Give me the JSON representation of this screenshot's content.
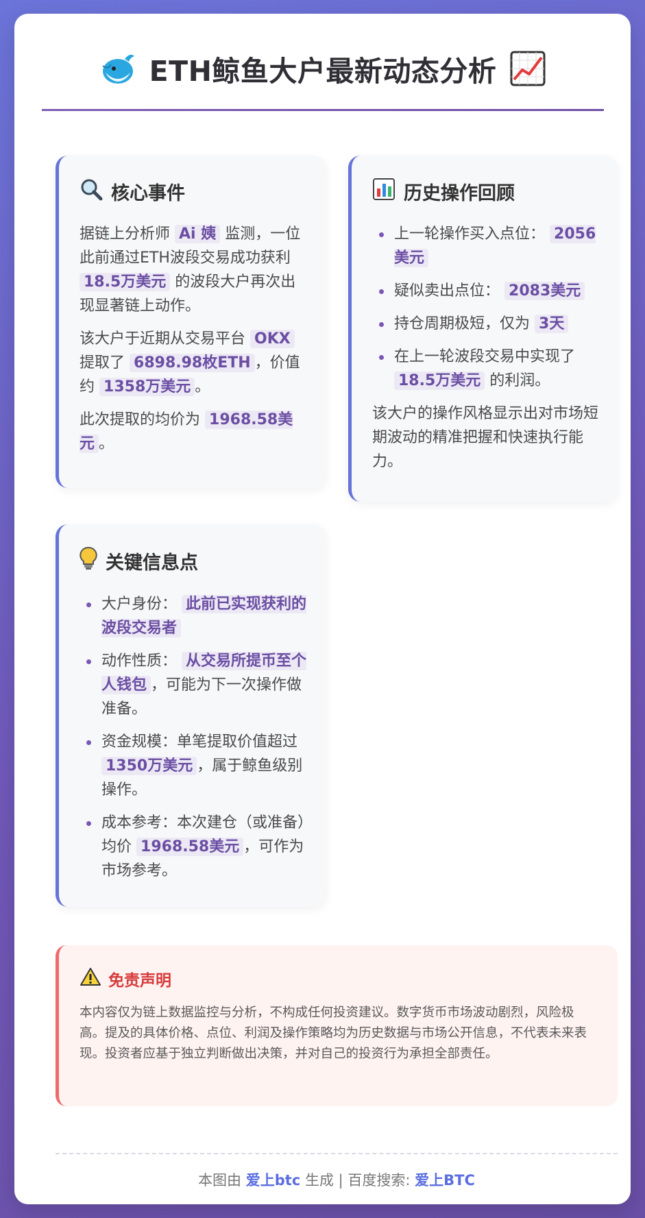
{
  "header": {
    "title": "ETH鲸鱼大户最新动态分析",
    "left_icon": "whale-icon",
    "right_icon": "chart-up-icon"
  },
  "core_event": {
    "title": "核心事件",
    "icon": "magnifier-icon",
    "p1": {
      "t1": "据链上分析师",
      "h1": "Ai 姨",
      "t2": "监测，一位此前通过ETH波段交易成功获利",
      "h2": "18.5万美元",
      "t3": "的波段大户再次出现显著链上动作。"
    },
    "p2": {
      "t1": "该大户于近期从交易平台",
      "h1": "OKX",
      "t2": "提取了",
      "h2": "6898.98枚ETH",
      "t3": "，价值约",
      "h3": "1358万美元",
      "t4": "。"
    },
    "p3": {
      "t1": "此次提取的均价为",
      "h1": "1968.58美元",
      "t2": "。"
    }
  },
  "history": {
    "title": "历史操作回顾",
    "icon": "bar-chart-icon",
    "items": [
      {
        "t1": "上一轮操作买入点位：",
        "h1": "2056美元",
        "t2": ""
      },
      {
        "t1": "疑似卖出点位：",
        "h1": "2083美元",
        "t2": ""
      },
      {
        "t1": "持仓周期极短，仅为",
        "h1": "3天",
        "t2": ""
      },
      {
        "t1": "在上一轮波段交易中实现了",
        "h1": "18.5万美元",
        "t2": "的利润。"
      }
    ],
    "note": "该大户的操作风格显示出对市场短期波动的精准把握和快速执行能力。"
  },
  "key_info": {
    "title": "关键信息点",
    "icon": "lightbulb-icon",
    "items": [
      {
        "t1": "大户身份：",
        "h1": "此前已实现获利的波段交易者",
        "t2": ""
      },
      {
        "t1": "动作性质：",
        "h1": "从交易所提币至个人钱包",
        "t2": "，可能为下一次操作做准备。"
      },
      {
        "t1": "资金规模：单笔提取价值超过",
        "h1": "1350万美元",
        "t2": "，属于鲸鱼级别操作。"
      },
      {
        "t1": "成本参考：本次建仓（或准备）均价",
        "h1": "1968.58美元",
        "t2": "，可作为市场参考。"
      }
    ]
  },
  "disclaimer": {
    "title": "免责声明",
    "icon": "warning-icon",
    "text": "本内容仅为链上数据监控与分析，不构成任何投资建议。数字货币市场波动剧烈，风险极高。提及的具体价格、点位、利润及操作策略均为历史数据与市场公开信息，不代表未来表现。投资者应基于独立判断做出决策，并对自己的投资行为承担全部责任。"
  },
  "footer": {
    "t1": "本图由",
    "brand": "爱上btc",
    "t2": "生成 | 百度搜索:",
    "search": "爱上BTC"
  },
  "colors": {
    "accent": "#6b4ea3",
    "panel_border": "#6673d9",
    "warning": "#d63b3b",
    "link": "#5b6ee0"
  }
}
